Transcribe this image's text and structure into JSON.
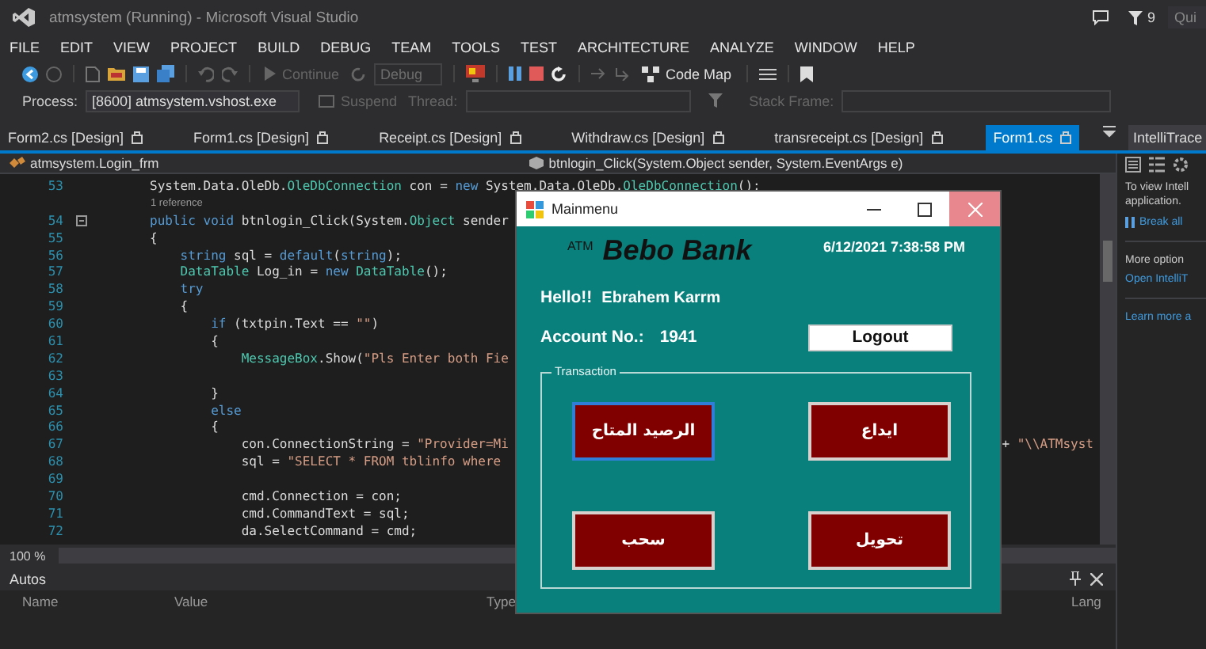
{
  "title_bar": {
    "title": "atmsystem (Running) - Microsoft Visual Studio",
    "notification_count": "9",
    "quick_launch": "Qui"
  },
  "menu": [
    "FILE",
    "EDIT",
    "VIEW",
    "PROJECT",
    "BUILD",
    "DEBUG",
    "TEAM",
    "TOOLS",
    "TEST",
    "ARCHITECTURE",
    "ANALYZE",
    "WINDOW",
    "HELP"
  ],
  "toolbar": {
    "continue": {
      "label": "Continue",
      "disabled": true
    },
    "configuration": "Debug",
    "code_map": "Code Map"
  },
  "debug_location": {
    "process_label": "Process:",
    "process": "[8600] atmsystem.vshost.exe",
    "suspend": {
      "label": "Suspend",
      "disabled": true
    },
    "thread_label": "Thread:",
    "stack_frame_label": "Stack Frame:"
  },
  "tabs": [
    {
      "label": "Form2.cs [Design]",
      "selected": false
    },
    {
      "label": "Form1.cs [Design]",
      "selected": false
    },
    {
      "label": "Receipt.cs [Design]",
      "selected": false
    },
    {
      "label": "Withdraw.cs [Design]",
      "selected": false
    },
    {
      "label": "transreceipt.cs [Design]",
      "selected": false
    },
    {
      "label": "Form1.cs",
      "selected": true
    }
  ],
  "editor": {
    "class_dropdown": "atmsystem.Login_frm",
    "member_dropdown": "btnlogin_Click(System.Object sender, System.EventArgs e)",
    "zoom": "100 %",
    "lines": [
      {
        "kind": "code",
        "number": "53",
        "collapsible": false,
        "segments": [
          {
            "kind": "plain",
            "text": "        System.Data.OleDb."
          },
          {
            "kind": "type",
            "text": "OleDbConnection"
          },
          {
            "kind": "plain",
            "text": " con = "
          },
          {
            "kind": "keyword",
            "text": "new"
          },
          {
            "kind": "plain",
            "text": " System.Data.OleDb."
          },
          {
            "kind": "type",
            "text": "OleDbConnection"
          },
          {
            "kind": "plain",
            "text": "();"
          }
        ]
      },
      {
        "kind": "codelens",
        "text": "1 reference"
      },
      {
        "kind": "code",
        "number": "54",
        "collapsible": true,
        "segments": [
          {
            "kind": "keyword",
            "text": "        public"
          },
          {
            "kind": "keyword",
            "text": " void"
          },
          {
            "kind": "plain",
            "text": " btnlogin_Click(System."
          },
          {
            "kind": "type",
            "text": "Object"
          },
          {
            "kind": "plain",
            "text": " sender"
          }
        ]
      },
      {
        "kind": "code",
        "number": "55",
        "collapsible": false,
        "segments": [
          {
            "kind": "plain",
            "text": "        {"
          }
        ]
      },
      {
        "kind": "code",
        "number": "56",
        "collapsible": false,
        "segments": [
          {
            "kind": "keyword",
            "text": "            string"
          },
          {
            "kind": "plain",
            "text": " sql = "
          },
          {
            "kind": "keyword",
            "text": "default"
          },
          {
            "kind": "plain",
            "text": "("
          },
          {
            "kind": "keyword",
            "text": "string"
          },
          {
            "kind": "plain",
            "text": ");"
          }
        ]
      },
      {
        "kind": "code",
        "number": "57",
        "collapsible": false,
        "segments": [
          {
            "kind": "type",
            "text": "            DataTable"
          },
          {
            "kind": "plain",
            "text": " Log_in = "
          },
          {
            "kind": "keyword",
            "text": "new"
          },
          {
            "kind": "type",
            "text": " DataTable"
          },
          {
            "kind": "plain",
            "text": "();"
          }
        ]
      },
      {
        "kind": "code",
        "number": "58",
        "collapsible": false,
        "segments": [
          {
            "kind": "keyword",
            "text": "            try"
          }
        ]
      },
      {
        "kind": "code",
        "number": "59",
        "collapsible": false,
        "segments": [
          {
            "kind": "plain",
            "text": "            {"
          }
        ]
      },
      {
        "kind": "code",
        "number": "60",
        "collapsible": false,
        "segments": [
          {
            "kind": "keyword",
            "text": "                if"
          },
          {
            "kind": "plain",
            "text": " (txtpin.Text == "
          },
          {
            "kind": "string",
            "text": "\"\""
          },
          {
            "kind": "plain",
            "text": ")"
          }
        ]
      },
      {
        "kind": "code",
        "number": "61",
        "collapsible": false,
        "segments": [
          {
            "kind": "plain",
            "text": "                {"
          }
        ]
      },
      {
        "kind": "code",
        "number": "62",
        "collapsible": false,
        "segments": [
          {
            "kind": "type",
            "text": "                    MessageBox"
          },
          {
            "kind": "plain",
            "text": ".Show("
          },
          {
            "kind": "string",
            "text": "\"Pls Enter both Fie"
          }
        ]
      },
      {
        "kind": "code",
        "number": "63",
        "collapsible": false
      },
      {
        "kind": "code",
        "number": "64",
        "collapsible": false,
        "segments": [
          {
            "kind": "plain",
            "text": "                }"
          }
        ]
      },
      {
        "kind": "code",
        "number": "65",
        "collapsible": false,
        "segments": [
          {
            "kind": "keyword",
            "text": "                else"
          }
        ]
      },
      {
        "kind": "code",
        "number": "66",
        "collapsible": false,
        "segments": [
          {
            "kind": "plain",
            "text": "                {"
          }
        ]
      },
      {
        "kind": "code",
        "number": "67",
        "collapsible": false,
        "segments": [
          {
            "kind": "plain",
            "text": "                    con.ConnectionString = "
          },
          {
            "kind": "string",
            "text": "\"Provider=Mi"
          }
        ],
        "tail": [
          {
            "kind": "plain",
            "text": "+ "
          },
          {
            "kind": "string",
            "text": "\"\\\\ATMsyst"
          }
        ]
      },
      {
        "kind": "code",
        "number": "68",
        "collapsible": false,
        "segments": [
          {
            "kind": "plain",
            "text": "                    sql = "
          },
          {
            "kind": "string",
            "text": "\"SELECT * FROM tblinfo where"
          }
        ]
      },
      {
        "kind": "code",
        "number": "69",
        "collapsible": false
      },
      {
        "kind": "code",
        "number": "70",
        "collapsible": false,
        "segments": [
          {
            "kind": "plain",
            "text": "                    cmd.Connection = con;"
          }
        ]
      },
      {
        "kind": "code",
        "number": "71",
        "collapsible": false,
        "segments": [
          {
            "kind": "plain",
            "text": "                    cmd.CommandText = sql;"
          }
        ]
      },
      {
        "kind": "code",
        "number": "72",
        "collapsible": false,
        "segments": [
          {
            "kind": "plain",
            "text": "                    da.SelectCommand = cmd;"
          }
        ]
      }
    ]
  },
  "intellitrace": {
    "title": "IntelliTrace",
    "message": [
      "To view Intell",
      "application."
    ],
    "break_all": "Break all",
    "more_options": "More option",
    "open_link": "Open IntelliT",
    "learn_more": "Learn more a"
  },
  "autos": {
    "title": "Autos",
    "columns": [
      "Name",
      "Value",
      "Type",
      "Lang"
    ]
  },
  "dialog": {
    "title": "Mainmenu",
    "logo_small": "ATM",
    "logo": "Bebo Bank",
    "datetime": "6/12/2021 7:38:58 PM",
    "greeting": "Hello!!",
    "user_name": "Ebrahem Karrm",
    "account_label": "Account No.:",
    "account_number": "1941",
    "logout": "Logout",
    "group_title": "Transaction",
    "balance_button": {
      "label": "الرصيد المتاح",
      "focused": true
    },
    "deposit_button": {
      "label": "ايداع",
      "focused": false
    },
    "withdraw_button": {
      "label": "سحب",
      "focused": false
    },
    "transfer_button": {
      "label": "تحويل",
      "focused": false
    }
  }
}
